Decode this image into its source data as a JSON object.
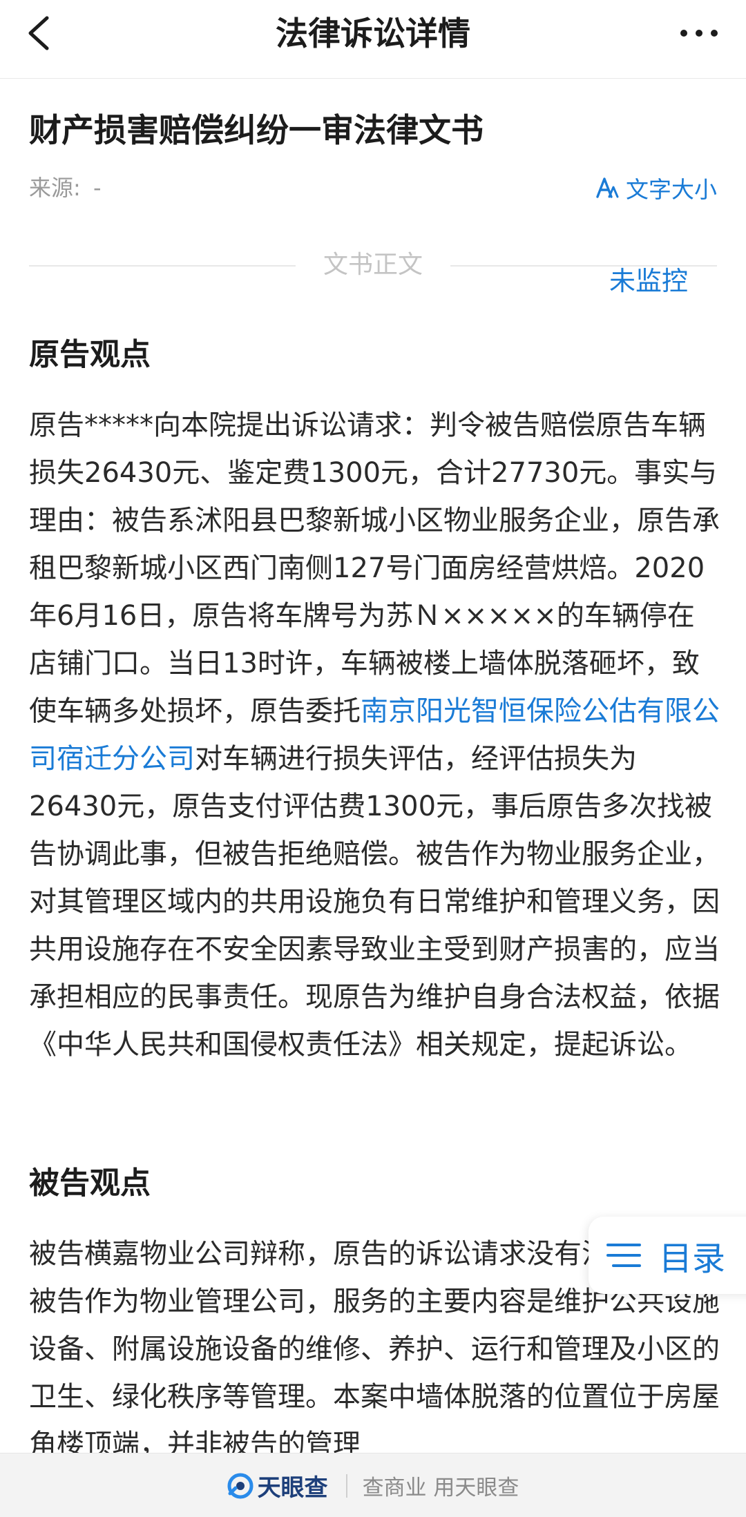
{
  "navbar": {
    "title": "法律诉讼详情"
  },
  "header": {
    "doc_title": "财产损害赔偿纠纷一审法律文书",
    "source_label": "来源:",
    "source_value": "-",
    "font_size_label": "文字大小"
  },
  "divider": {
    "label": "文书正文"
  },
  "watch_label": "未监控",
  "sections": {
    "plaintiff": {
      "heading": "原告观点",
      "text_before_link": "原告*****向本院提出诉讼请求：判令被告赔偿原告车辆损失26430元、鉴定费1300元，合计27730元。事实与理由：被告系沭阳县巴黎新城小区物业服务企业，原告承租巴黎新城小区西门南侧127号门面房经营烘焙。2020年6月16日，原告将车牌号为苏Ｎ×××××的车辆停在店铺门口。当日13时许，车辆被楼上墙体脱落砸坏，致使车辆多处损坏，原告委托",
      "link_text": "南京阳光智恒保险公估有限公司宿迁分公司",
      "text_after_link": "对车辆进行损失评估，经评估损失为26430元，原告支付评估费1300元，事后原告多次找被告协调此事，但被告拒绝赔偿。被告作为物业服务企业，对其管理区域内的共用设施负有日常维护和管理义务，因共用设施存在不安全因素导致业主受到财产损害的，应当承担相应的民事责任。现原告为维护自身合法权益，依据《中华人民共和国侵权责任法》相关规定，提起诉讼。"
    },
    "defendant": {
      "heading": "被告观点",
      "text": "被告横嘉物业公司辩称，原告的诉讼请求没有法律依据，被告作为物业管理公司，服务的主要内容是维护公共设施设备、附属设施设备的维修、养护、运行和管理及小区的卫生、绿化秩序等管理。本案中墙体脱落的位置位于房屋角楼顶端，并非被告的管理"
    }
  },
  "toc": {
    "label": "目录"
  },
  "footer": {
    "brand": "天眼查",
    "slogan": "查商业 用天眼查"
  },
  "colors": {
    "accent": "#1a7bd6",
    "brand_navy": "#1d3f7a"
  }
}
